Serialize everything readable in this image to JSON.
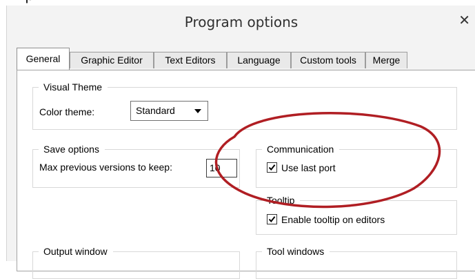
{
  "window": {
    "title": "Program options"
  },
  "tabs": [
    {
      "label": "General"
    },
    {
      "label": "Graphic Editor"
    },
    {
      "label": "Text Editors"
    },
    {
      "label": "Language"
    },
    {
      "label": "Custom tools"
    },
    {
      "label": "Merge"
    }
  ],
  "active_tab": "General",
  "visual_theme": {
    "title": "Visual Theme",
    "color_label": "Color theme:",
    "color_value": "Standard"
  },
  "save_options": {
    "title": "Save options",
    "max_label": "Max previous versions to keep:",
    "max_value": "10"
  },
  "communication": {
    "title": "Communication",
    "use_last_port": {
      "label": "Use last port",
      "checked": true
    }
  },
  "tooltip": {
    "title": "Tooltip",
    "enable_tooltip": {
      "label": "Enable tooltip on editors",
      "checked": true
    }
  },
  "output_window": {
    "title": "Output window"
  },
  "tool_windows": {
    "title": "Tool windows"
  },
  "colors": {
    "annotation": "#b01e23",
    "window_bg": "#f3f3f3",
    "panel_bg": "#ffffff"
  },
  "icons": {
    "close": "close-icon",
    "dropdown": "chevron-down-icon",
    "check": "check-icon"
  }
}
